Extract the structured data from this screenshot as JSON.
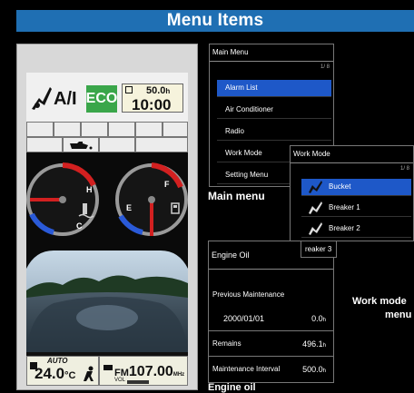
{
  "header": {
    "title": "Menu Items"
  },
  "monitor": {
    "ac_label": "A/I",
    "eco_label": "ECO",
    "hour_meter": "50.0",
    "hour_unit": "h",
    "clock": "10:00",
    "gauge_hot_label": "H",
    "gauge_cold_label": "C",
    "gauge_full_label": "F",
    "gauge_empty_label": "E",
    "climate_mode": "AUTO",
    "temperature": "24.0",
    "temperature_unit": "°C",
    "radio_band": "FM",
    "radio_freq": "107.00",
    "radio_unit": "MHz",
    "volume_label": "VOL"
  },
  "main_menu": {
    "title": "Main Menu",
    "page": "1/ 8",
    "items": [
      "Alarm List",
      "Air Conditioner",
      "Radio",
      "Work Mode",
      "Setting Menu"
    ],
    "selected_index": 0,
    "caption": "Main menu"
  },
  "work_menu": {
    "title": "Work Mode",
    "page": "1/ 8",
    "items": [
      "Bucket",
      "Breaker 1",
      "Breaker 2",
      "reaker 3"
    ],
    "selected_index": 0,
    "caption_line1": "Work mode",
    "caption_line2": "menu"
  },
  "engine_oil": {
    "title": "Engine Oil",
    "previous_label": "Previous Maintenance",
    "previous_date": "2000/01/01",
    "previous_value": "0.0",
    "remains_label": "Remains",
    "remains_value": "496.1",
    "interval_label": "Maintenance Interval",
    "interval_value": "500.0",
    "unit": "h",
    "caption": "Engine oil"
  },
  "colors": {
    "banner": "#1f6fb3",
    "selection": "#1e58c8",
    "eco": "#3aa64a",
    "gauge_hot": "#d22020",
    "gauge_cold": "#2a5ad8"
  }
}
